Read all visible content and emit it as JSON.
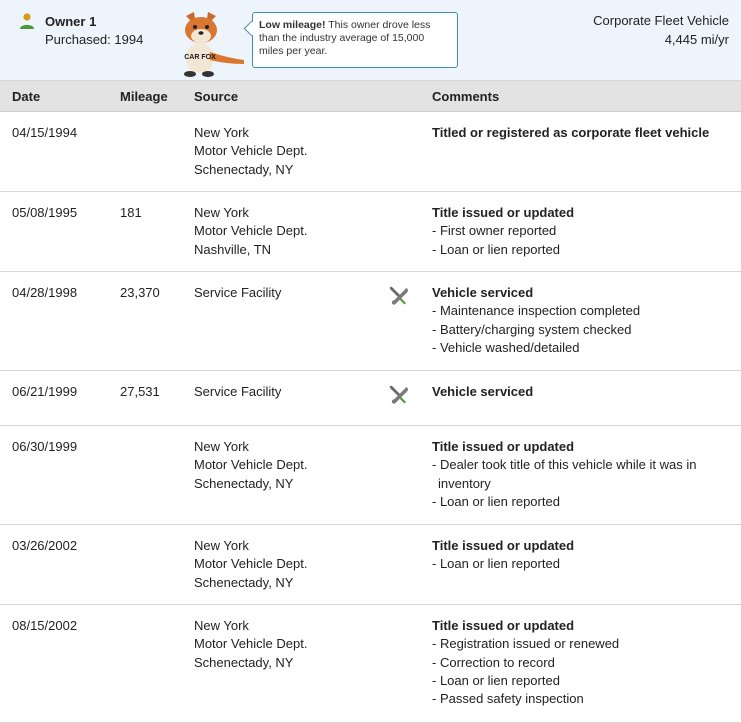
{
  "owner": {
    "title": "Owner 1",
    "purchased": "Purchased: 1994",
    "usage_type": "Corporate Fleet Vehicle",
    "usage_rate": "4,445 mi/yr",
    "callout_bold": "Low mileage!",
    "callout_text": " This owner drove less than the industry average of 15,000 miles per year.",
    "mascot_text": "CAR FOX",
    "icon": "person-icon",
    "accent_color": "#3f8fa4"
  },
  "table": {
    "headers": {
      "date": "Date",
      "mileage": "Mileage",
      "source": "Source",
      "comments": "Comments"
    },
    "rows": [
      {
        "date": "04/15/1994",
        "mileage": "",
        "source": [
          "New York",
          "Motor Vehicle Dept.",
          "Schenectady, NY"
        ],
        "service_icon": false,
        "comment_title": "Titled or registered as corporate fleet vehicle",
        "comment_items": []
      },
      {
        "date": "05/08/1995",
        "mileage": "181",
        "source": [
          "New York",
          "Motor Vehicle Dept.",
          "Nashville, TN"
        ],
        "service_icon": false,
        "comment_title": "Title issued or updated",
        "comment_items": [
          "First owner reported",
          "Loan or lien reported"
        ]
      },
      {
        "date": "04/28/1998",
        "mileage": "23,370",
        "source": [
          "Service Facility"
        ],
        "service_icon": true,
        "comment_title": "Vehicle serviced",
        "comment_items": [
          "Maintenance inspection completed",
          "Battery/charging system checked",
          "Vehicle washed/detailed"
        ]
      },
      {
        "date": "06/21/1999",
        "mileage": "27,531",
        "source": [
          "Service Facility"
        ],
        "service_icon": true,
        "comment_title": "Vehicle serviced",
        "comment_items": []
      },
      {
        "date": "06/30/1999",
        "mileage": "",
        "source": [
          "New York",
          "Motor Vehicle Dept.",
          "Schenectady, NY"
        ],
        "service_icon": false,
        "comment_title": "Title issued or updated",
        "comment_items": [
          "Dealer took title of this vehicle while it was in inventory",
          "Loan or lien reported"
        ]
      },
      {
        "date": "03/26/2002",
        "mileage": "",
        "source": [
          "New York",
          "Motor Vehicle Dept.",
          "Schenectady, NY"
        ],
        "service_icon": false,
        "comment_title": "Title issued or updated",
        "comment_items": [
          "Loan or lien reported"
        ]
      },
      {
        "date": "08/15/2002",
        "mileage": "",
        "source": [
          "New York",
          "Motor Vehicle Dept.",
          "Schenectady, NY"
        ],
        "service_icon": false,
        "comment_title": "Title issued or updated",
        "comment_items": [
          "Registration issued or renewed",
          "Correction to record",
          "Loan or lien reported",
          "Passed safety inspection"
        ]
      }
    ]
  }
}
